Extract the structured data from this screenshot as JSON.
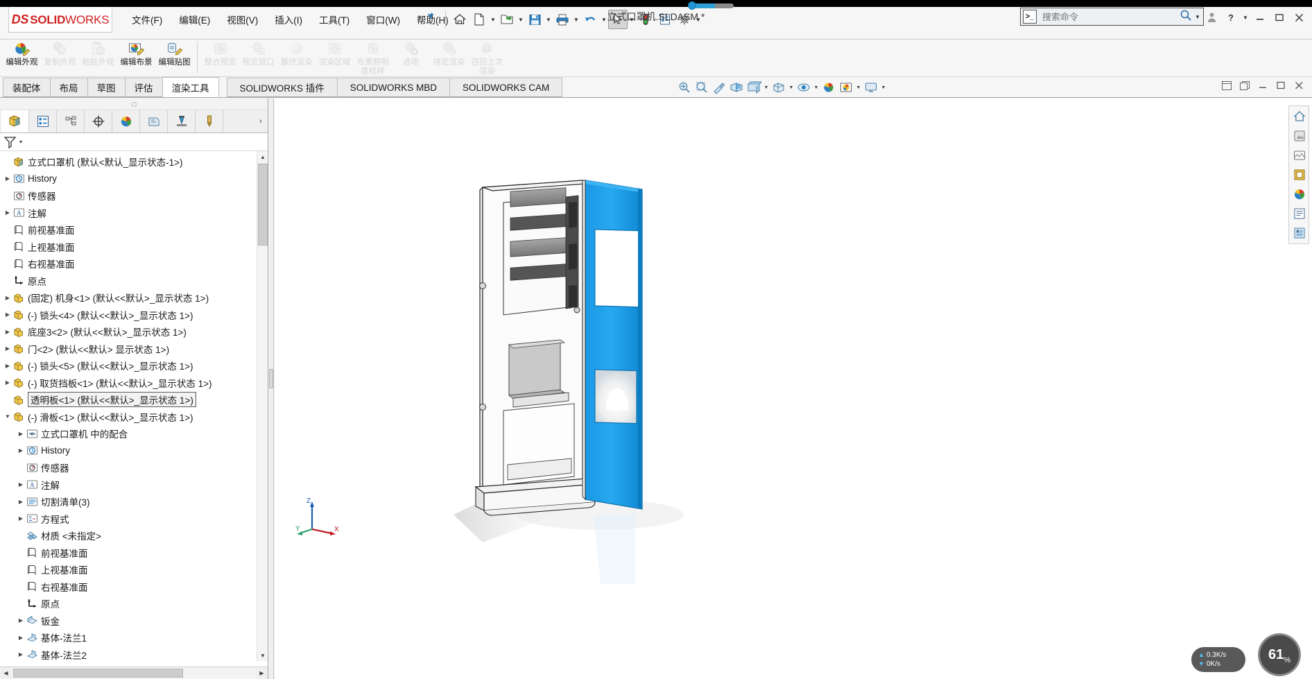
{
  "app": {
    "brand_ds": "DS",
    "brand_solid": "SOLID",
    "brand_works": "WORKS",
    "document_title": "立式口罩机.SLDASM *"
  },
  "menubar": {
    "items": [
      {
        "label": "文件(F)",
        "name": "menu-file"
      },
      {
        "label": "编辑(E)",
        "name": "menu-edit"
      },
      {
        "label": "视图(V)",
        "name": "menu-view"
      },
      {
        "label": "插入(I)",
        "name": "menu-insert"
      },
      {
        "label": "工具(T)",
        "name": "menu-tools"
      },
      {
        "label": "窗口(W)",
        "name": "menu-window"
      },
      {
        "label": "帮助(H)",
        "name": "menu-help"
      }
    ],
    "pin_icon": "pin-icon"
  },
  "quick_access": {
    "buttons": [
      {
        "name": "home-icon",
        "tip": "主页"
      },
      {
        "name": "new-document-icon",
        "tip": "新建"
      },
      {
        "name": "open-document-icon",
        "tip": "打开"
      },
      {
        "name": "save-icon",
        "tip": "保存"
      },
      {
        "name": "print-icon",
        "tip": "打印"
      },
      {
        "name": "undo-icon",
        "tip": "撤销"
      },
      {
        "name": "select-cursor-icon",
        "tip": "选择"
      },
      {
        "name": "rebuild-traffic-light-icon",
        "tip": "重建模型"
      },
      {
        "name": "file-properties-icon",
        "tip": "文件属性"
      },
      {
        "name": "options-gear-icon",
        "tip": "选项"
      }
    ]
  },
  "search": {
    "placeholder": "搜索命令",
    "value": "",
    "icon": "search-icon"
  },
  "window_controls": {
    "user": "user-account-icon",
    "help": "help-question-icon",
    "minimize": "minimize-icon",
    "maximize": "maximize-icon",
    "close": "close-icon"
  },
  "ribbon": {
    "groups": [
      {
        "items": [
          {
            "label": "编辑外观",
            "name": "ribbon-edit-appearance",
            "icon": "appearance-pencil-icon",
            "enabled": true
          },
          {
            "label": "复制外观",
            "name": "ribbon-copy-appearance",
            "icon": "copy-appearance-icon",
            "enabled": false
          },
          {
            "label": "粘贴外观",
            "name": "ribbon-paste-appearance",
            "icon": "paste-appearance-icon",
            "enabled": false
          },
          {
            "label": "编辑布景",
            "name": "ribbon-edit-scene",
            "icon": "edit-scene-icon",
            "enabled": true
          },
          {
            "label": "编辑贴图",
            "name": "ribbon-edit-decal",
            "icon": "edit-decal-icon",
            "enabled": true
          }
        ]
      },
      {
        "items": [
          {
            "label": "整合预览",
            "name": "ribbon-integrated-preview",
            "icon": "integrated-preview-icon",
            "enabled": false
          },
          {
            "label": "预览窗口",
            "name": "ribbon-preview-window",
            "icon": "preview-window-icon",
            "enabled": false
          },
          {
            "label": "最终渲染",
            "name": "ribbon-final-render",
            "icon": "final-render-icon",
            "enabled": false
          },
          {
            "label": "渲染区域",
            "name": "ribbon-render-region",
            "icon": "render-region-icon",
            "enabled": false
          },
          {
            "label": "布景照明度校样",
            "name": "ribbon-scene-illumination-proof",
            "icon": "scene-illumination-icon",
            "enabled": false
          },
          {
            "label": "选项",
            "name": "ribbon-options",
            "icon": "render-options-icon",
            "enabled": false
          },
          {
            "label": "排定渲染",
            "name": "ribbon-schedule-render",
            "icon": "schedule-render-icon",
            "enabled": false
          },
          {
            "label": "召回上次渲染",
            "name": "ribbon-recall-last-render",
            "icon": "recall-render-icon",
            "enabled": false
          }
        ]
      }
    ]
  },
  "tabs": {
    "items": [
      {
        "label": "装配体",
        "name": "tab-assembly",
        "active": false
      },
      {
        "label": "布局",
        "name": "tab-layout",
        "active": false
      },
      {
        "label": "草图",
        "name": "tab-sketch",
        "active": false
      },
      {
        "label": "评估",
        "name": "tab-evaluate",
        "active": false
      },
      {
        "label": "渲染工具",
        "name": "tab-render-tools",
        "active": true
      },
      {
        "label": "SOLIDWORKS 插件",
        "name": "tab-solidworks-addins",
        "active": false
      },
      {
        "label": "SOLIDWORKS MBD",
        "name": "tab-solidworks-mbd",
        "active": false
      },
      {
        "label": "SOLIDWORKS CAM",
        "name": "tab-solidworks-cam",
        "active": false
      }
    ]
  },
  "view_toolbar": {
    "buttons": [
      {
        "name": "zoom-to-fit-icon"
      },
      {
        "name": "zoom-to-area-icon"
      },
      {
        "name": "previous-view-icon"
      },
      {
        "name": "section-view-icon"
      },
      {
        "name": "view-orientation-icon"
      },
      {
        "name": "display-style-icon"
      },
      {
        "name": "hide-show-items-icon"
      },
      {
        "name": "edit-appearance-icon"
      },
      {
        "name": "apply-scene-icon"
      },
      {
        "name": "view-settings-icon"
      }
    ]
  },
  "document_window_controls": {
    "restore": "restore-doc-icon",
    "minimize": "minimize-doc-icon",
    "maximize": "maximize-doc-icon",
    "close": "close-doc-icon",
    "extra": "doc-grid-icon"
  },
  "feature_manager": {
    "tabs": [
      {
        "name": "fm-tab-feature-tree",
        "icon": "feature-tree-icon",
        "active": true
      },
      {
        "name": "fm-tab-property-manager",
        "icon": "property-manager-icon",
        "active": false
      },
      {
        "name": "fm-tab-configuration-manager",
        "icon": "configuration-manager-icon",
        "active": false
      },
      {
        "name": "fm-tab-dimxpert-manager",
        "icon": "dimxpert-icon",
        "active": false
      },
      {
        "name": "fm-tab-display-manager",
        "icon": "display-manager-icon",
        "active": false
      },
      {
        "name": "fm-tab-render-manager",
        "icon": "render-manager-icon",
        "active": false
      },
      {
        "name": "fm-tab-simulation-manager",
        "icon": "simulation-manager-icon",
        "active": false
      },
      {
        "name": "fm-tab-cam-manager",
        "icon": "cam-manager-icon",
        "active": false
      }
    ],
    "filter_icon": "filter-funnel-icon",
    "tree": [
      {
        "label": "立式口罩机  (默认<默认_显示状态-1>)",
        "indent": 0,
        "arrow": "none",
        "icon": "assembly-icon",
        "selected": false
      },
      {
        "label": "History",
        "indent": 0,
        "arrow": "right",
        "icon": "history-icon",
        "selected": false
      },
      {
        "label": "传感器",
        "indent": 0,
        "arrow": "none",
        "icon": "sensor-icon",
        "selected": false
      },
      {
        "label": "注解",
        "indent": 0,
        "arrow": "right",
        "icon": "annotation-icon",
        "selected": false
      },
      {
        "label": "前视基准面",
        "indent": 0,
        "arrow": "none",
        "icon": "plane-icon",
        "selected": false
      },
      {
        "label": "上视基准面",
        "indent": 0,
        "arrow": "none",
        "icon": "plane-icon",
        "selected": false
      },
      {
        "label": "右视基准面",
        "indent": 0,
        "arrow": "none",
        "icon": "plane-icon",
        "selected": false
      },
      {
        "label": "原点",
        "indent": 0,
        "arrow": "none",
        "icon": "origin-icon",
        "selected": false
      },
      {
        "label": "(固定) 机身<1> (默认<<默认>_显示状态 1>)",
        "indent": 0,
        "arrow": "right",
        "icon": "part-icon",
        "selected": false
      },
      {
        "label": "(-) 锁头<4> (默认<<默认>_显示状态 1>)",
        "indent": 0,
        "arrow": "right",
        "icon": "part-icon",
        "selected": false
      },
      {
        "label": "底座3<2> (默认<<默认>_显示状态 1>)",
        "indent": 0,
        "arrow": "right",
        "icon": "part-icon",
        "selected": false
      },
      {
        "label": "门<2> (默认<<默认> 显示状态 1>)",
        "indent": 0,
        "arrow": "right",
        "icon": "part-icon",
        "selected": false
      },
      {
        "label": "(-) 锁头<5> (默认<<默认>_显示状态 1>)",
        "indent": 0,
        "arrow": "right",
        "icon": "part-icon",
        "selected": false
      },
      {
        "label": "(-) 取货挡板<1> (默认<<默认>_显示状态 1>)",
        "indent": 0,
        "arrow": "right",
        "icon": "part-icon",
        "selected": false
      },
      {
        "label": "透明板<1> (默认<<默认>_显示状态 1>)",
        "indent": 0,
        "arrow": "none",
        "icon": "part-icon",
        "selected": true
      },
      {
        "label": "(-) 滑板<1> (默认<<默认>_显示状态 1>)",
        "indent": 0,
        "arrow": "down",
        "icon": "part-icon",
        "selected": false
      },
      {
        "label": "立式口罩机 中的配合",
        "indent": 1,
        "arrow": "right",
        "icon": "mates-icon",
        "selected": false
      },
      {
        "label": "History",
        "indent": 1,
        "arrow": "right",
        "icon": "history-icon",
        "selected": false
      },
      {
        "label": "传感器",
        "indent": 1,
        "arrow": "none",
        "icon": "sensor-icon",
        "selected": false
      },
      {
        "label": "注解",
        "indent": 1,
        "arrow": "right",
        "icon": "annotation-icon",
        "selected": false
      },
      {
        "label": "切割清单(3)",
        "indent": 1,
        "arrow": "right",
        "icon": "cutlist-icon",
        "selected": false
      },
      {
        "label": "方程式",
        "indent": 1,
        "arrow": "right",
        "icon": "equations-icon",
        "selected": false
      },
      {
        "label": "材质 <未指定>",
        "indent": 1,
        "arrow": "none",
        "icon": "material-icon",
        "selected": false
      },
      {
        "label": "前视基准面",
        "indent": 1,
        "arrow": "none",
        "icon": "plane-icon",
        "selected": false
      },
      {
        "label": "上视基准面",
        "indent": 1,
        "arrow": "none",
        "icon": "plane-icon",
        "selected": false
      },
      {
        "label": "右视基准面",
        "indent": 1,
        "arrow": "none",
        "icon": "plane-icon",
        "selected": false
      },
      {
        "label": "原点",
        "indent": 1,
        "arrow": "none",
        "icon": "origin-icon",
        "selected": false
      },
      {
        "label": "钣金",
        "indent": 1,
        "arrow": "right",
        "icon": "sheetmetal-icon",
        "selected": false
      },
      {
        "label": "基体-法兰1",
        "indent": 1,
        "arrow": "right",
        "icon": "flange-icon",
        "selected": false
      },
      {
        "label": "基体-法兰2",
        "indent": 1,
        "arrow": "right",
        "icon": "flange-icon",
        "selected": false
      }
    ]
  },
  "viewport": {
    "triad": {
      "x_label": "X",
      "y_label": "Y",
      "z_label": "Z"
    },
    "model_colors": {
      "door_blue": "#1e9ce8",
      "body_white": "#f2f2f2",
      "interior_gray": "#8d8d8d",
      "outline": "#2a2a2a"
    }
  },
  "right_dock": {
    "buttons": [
      {
        "name": "view-home-icon"
      },
      {
        "name": "appearances-icon"
      },
      {
        "name": "scenes-lights-cameras-icon"
      },
      {
        "name": "decals-icon"
      },
      {
        "name": "appearance-sphere-icon"
      },
      {
        "name": "custom-properties-icon"
      },
      {
        "name": "design-library-icon"
      }
    ]
  },
  "status": {
    "upload_speed": "0.3K/s",
    "download_speed": "0K/s",
    "zoom_value": "61",
    "zoom_unit": "%"
  }
}
